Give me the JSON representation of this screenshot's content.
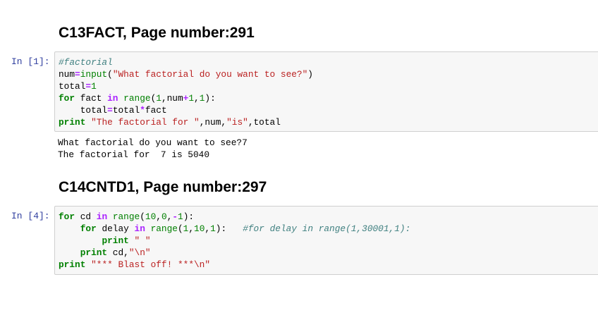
{
  "cells": [
    {
      "heading": "C13FACT, Page number:291",
      "prompt": "In [1]:",
      "code": [
        [
          [
            "cm",
            "#factorial"
          ]
        ],
        [
          [
            "",
            "num"
          ],
          [
            "op",
            "="
          ],
          [
            "bi",
            "input"
          ],
          [
            "",
            "("
          ],
          [
            "st",
            "\"What factorial do you want to see?\""
          ],
          [
            "",
            ")"
          ]
        ],
        [
          [
            "",
            "total"
          ],
          [
            "op",
            "="
          ],
          [
            "nu",
            "1"
          ]
        ],
        [
          [
            "kw",
            "for"
          ],
          [
            "",
            " fact "
          ],
          [
            "ow",
            "in"
          ],
          [
            "",
            " "
          ],
          [
            "bi",
            "range"
          ],
          [
            "",
            "("
          ],
          [
            "nu",
            "1"
          ],
          [
            "",
            ",num"
          ],
          [
            "op",
            "+"
          ],
          [
            "nu",
            "1"
          ],
          [
            "",
            ","
          ],
          [
            "nu",
            "1"
          ],
          [
            "",
            "):"
          ]
        ],
        [
          [
            "",
            "    total"
          ],
          [
            "op",
            "="
          ],
          [
            "",
            "total"
          ],
          [
            "op",
            "*"
          ],
          [
            "",
            "fact"
          ]
        ],
        [
          [
            "kw",
            "print"
          ],
          [
            "",
            " "
          ],
          [
            "st",
            "\"The factorial for \""
          ],
          [
            "",
            ",num,"
          ],
          [
            "st",
            "\"is\""
          ],
          [
            "",
            ",total"
          ]
        ]
      ],
      "output": [
        "What factorial do you want to see?7",
        "The factorial for  7 is 5040"
      ]
    },
    {
      "heading": "C14CNTD1, Page number:297",
      "prompt": "In [4]:",
      "code": [
        [
          [
            "kw",
            "for"
          ],
          [
            "",
            " cd "
          ],
          [
            "ow",
            "in"
          ],
          [
            "",
            " "
          ],
          [
            "bi",
            "range"
          ],
          [
            "",
            "("
          ],
          [
            "nu",
            "10"
          ],
          [
            "",
            ","
          ],
          [
            "nu",
            "0"
          ],
          [
            "",
            ","
          ],
          [
            "op",
            "-"
          ],
          [
            "nu",
            "1"
          ],
          [
            "",
            "):"
          ]
        ],
        [
          [
            "",
            "    "
          ],
          [
            "kw",
            "for"
          ],
          [
            "",
            " delay "
          ],
          [
            "ow",
            "in"
          ],
          [
            "",
            " "
          ],
          [
            "bi",
            "range"
          ],
          [
            "",
            "("
          ],
          [
            "nu",
            "1"
          ],
          [
            "",
            ","
          ],
          [
            "nu",
            "10"
          ],
          [
            "",
            ","
          ],
          [
            "nu",
            "1"
          ],
          [
            "",
            "):   "
          ],
          [
            "cm",
            "#for delay in range(1,30001,1):"
          ]
        ],
        [
          [
            "",
            "        "
          ],
          [
            "kw",
            "print"
          ],
          [
            "",
            " "
          ],
          [
            "st",
            "\" \""
          ]
        ],
        [
          [
            "",
            "    "
          ],
          [
            "kw",
            "print"
          ],
          [
            "",
            " cd,"
          ],
          [
            "st",
            "\"\\n\""
          ]
        ],
        [
          [
            "kw",
            "print"
          ],
          [
            "",
            " "
          ],
          [
            "st",
            "\"*** Blast off! ***\\n\""
          ]
        ]
      ],
      "output": []
    }
  ]
}
